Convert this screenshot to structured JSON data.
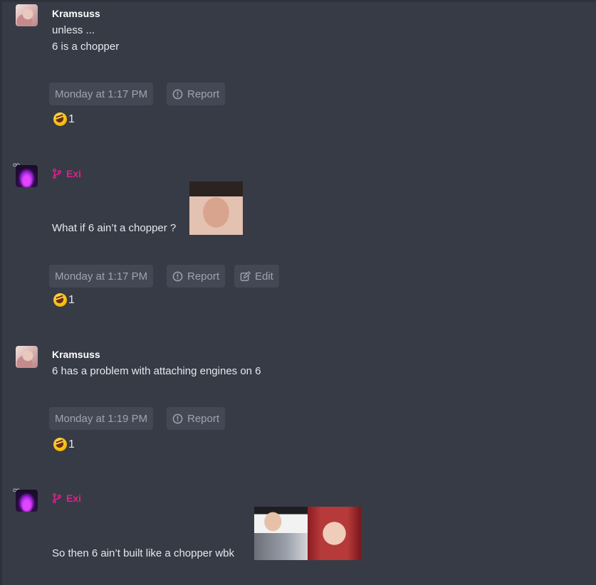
{
  "posts": [
    {
      "author": "Kramsuss",
      "lines": [
        "unless ...",
        "6 is a chopper"
      ],
      "timestamp": "Monday at 1:17 PM",
      "report_label": "Report",
      "reaction": {
        "emoji": "rolling-on-floor-laughing",
        "count": "1"
      }
    },
    {
      "author": "Exi",
      "lines": [
        "What if 6 ain’t a chopper ?"
      ],
      "timestamp": "Monday at 1:17 PM",
      "report_label": "Report",
      "edit_label": "Edit",
      "reaction": {
        "emoji": "rolling-on-floor-laughing",
        "count": "1"
      }
    },
    {
      "author": "Kramsuss",
      "lines": [
        "6 has a problem with attaching engines on 6"
      ],
      "timestamp": "Monday at 1:19 PM",
      "report_label": "Report",
      "reaction": {
        "emoji": "rolling-on-floor-laughing",
        "count": "1"
      }
    },
    {
      "author": "Exi",
      "lines": [
        "So then 6 ain’t built like a chopper wbk"
      ]
    }
  ],
  "colors": {
    "background": "#373b46",
    "chip_bg": "#434855",
    "chip_text": "#9ea3ae",
    "exi_name": "#e0208f"
  }
}
